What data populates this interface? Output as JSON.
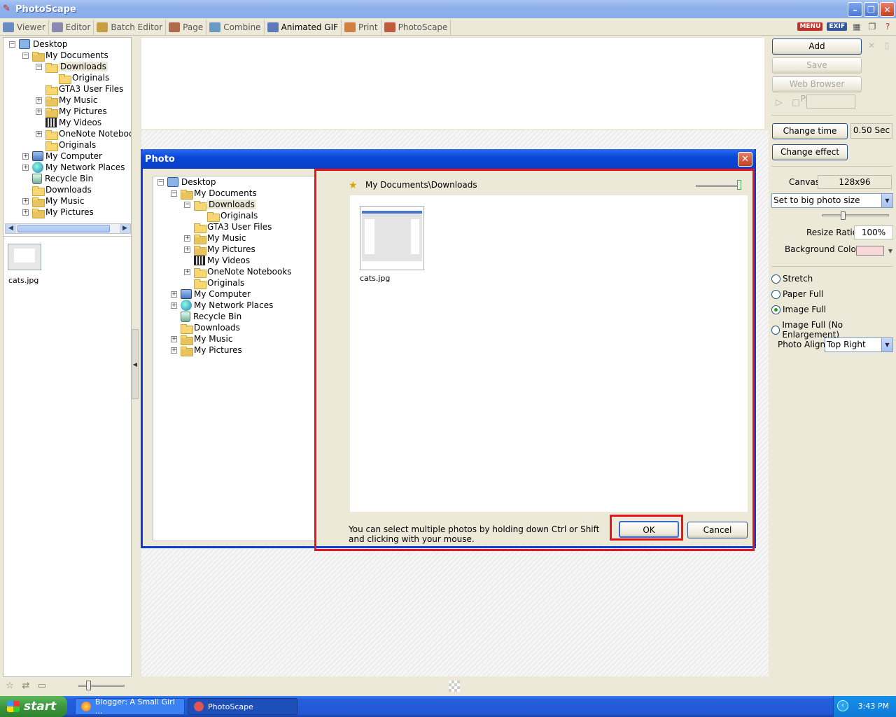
{
  "window": {
    "title": "PhotoScape",
    "buttons": {
      "minimize": "–",
      "restore": "❐",
      "close": "✕"
    }
  },
  "tabs": [
    {
      "label": "Viewer",
      "color": "#6a8cc0"
    },
    {
      "label": "Editor",
      "color": "#8a8ab0"
    },
    {
      "label": "Batch Editor",
      "color": "#c4a040"
    },
    {
      "label": "Page",
      "color": "#b06a4a"
    },
    {
      "label": "Combine",
      "color": "#6a9ac0"
    },
    {
      "label": "Animated GIF",
      "color": "#5a7ab8"
    },
    {
      "label": "Print",
      "color": "#d08040"
    },
    {
      "label": "PhotoScape",
      "color": "#c05a3a"
    }
  ],
  "toolbar": {
    "menu": "MENU",
    "exif": "EXIF"
  },
  "left_tree": [
    {
      "label": "Desktop",
      "icon": "desktop",
      "level": 0,
      "expander": "−"
    },
    {
      "label": "My Documents",
      "icon": "folder-special",
      "level": 1,
      "expander": "−"
    },
    {
      "label": "Downloads",
      "icon": "folder",
      "level": 2,
      "expander": "−",
      "selected": true
    },
    {
      "label": "Originals",
      "icon": "folder",
      "level": 3
    },
    {
      "label": "GTA3 User Files",
      "icon": "folder",
      "level": 2
    },
    {
      "label": "My Music",
      "icon": "folder-special",
      "level": 2,
      "expander": "+"
    },
    {
      "label": "My Pictures",
      "icon": "folder-special",
      "level": 2,
      "expander": "+"
    },
    {
      "label": "My Videos",
      "icon": "film",
      "level": 2
    },
    {
      "label": "OneNote Noteboo",
      "icon": "folder",
      "level": 2,
      "expander": "+"
    },
    {
      "label": "Originals",
      "icon": "folder",
      "level": 2
    },
    {
      "label": "My Computer",
      "icon": "computer",
      "level": 1,
      "expander": "+"
    },
    {
      "label": "My Network Places",
      "icon": "globe",
      "level": 1,
      "expander": "+"
    },
    {
      "label": "Recycle Bin",
      "icon": "bin",
      "level": 1
    },
    {
      "label": "Downloads",
      "icon": "folder",
      "level": 1
    },
    {
      "label": "My Music",
      "icon": "folder-special",
      "level": 1,
      "expander": "+"
    },
    {
      "label": "My Pictures",
      "icon": "folder-special",
      "level": 1,
      "expander": "+"
    }
  ],
  "left_thumbs": {
    "file": "cats.jpg"
  },
  "dialog": {
    "title": "Photo",
    "close": "✕",
    "tree": [
      {
        "label": "Desktop",
        "icon": "desktop",
        "level": 0,
        "expander": "−"
      },
      {
        "label": "My Documents",
        "icon": "folder-special",
        "level": 1,
        "expander": "−"
      },
      {
        "label": "Downloads",
        "icon": "folder",
        "level": 2,
        "expander": "−",
        "selected": true
      },
      {
        "label": "Originals",
        "icon": "folder",
        "level": 3
      },
      {
        "label": "GTA3 User Files",
        "icon": "folder",
        "level": 2
      },
      {
        "label": "My Music",
        "icon": "folder-special",
        "level": 2,
        "expander": "+"
      },
      {
        "label": "My Pictures",
        "icon": "folder-special",
        "level": 2,
        "expander": "+"
      },
      {
        "label": "My Videos",
        "icon": "film",
        "level": 2
      },
      {
        "label": "OneNote Notebooks",
        "icon": "folder",
        "level": 2,
        "expander": "+"
      },
      {
        "label": "Originals",
        "icon": "folder",
        "level": 2
      },
      {
        "label": "My Computer",
        "icon": "computer",
        "level": 1,
        "expander": "+"
      },
      {
        "label": "My Network Places",
        "icon": "globe",
        "level": 1,
        "expander": "+"
      },
      {
        "label": "Recycle Bin",
        "icon": "bin",
        "level": 1
      },
      {
        "label": "Downloads",
        "icon": "folder",
        "level": 1
      },
      {
        "label": "My Music",
        "icon": "folder-special",
        "level": 1,
        "expander": "+"
      },
      {
        "label": "My Pictures",
        "icon": "folder-special",
        "level": 1,
        "expander": "+"
      }
    ],
    "path": "My Documents\\Downloads",
    "files": [
      {
        "name": "cats.jpg"
      }
    ],
    "hint": "You can select multiple photos by holding down Ctrl or Shift and clicking with your mouse.",
    "ok_label": "OK",
    "cancel_label": "Cancel",
    "highlight_color": "#e8141c"
  },
  "right_panel": {
    "add_label": "Add",
    "save_label": "Save",
    "preview_label": "Web Browser Preview",
    "change_time_label": "Change time",
    "time_value": "0.50 Sec",
    "change_effect_label": "Change effect",
    "canvas_label": "Canvas",
    "canvas_value": "128x96",
    "size_mode": "Set to big photo size",
    "resize_ratio_label": "Resize Ratio",
    "resize_ratio_value": "100%",
    "bg_color_label": "Background Color",
    "bg_color": "#f8d8d8",
    "radios": [
      {
        "label": "Stretch",
        "checked": false
      },
      {
        "label": "Paper Full",
        "checked": false
      },
      {
        "label": "Image Full",
        "checked": true
      },
      {
        "label": "Image Full (No Enlargement)",
        "checked": false
      }
    ],
    "photo_align_label": "Photo Align",
    "photo_align_value": "Top Right"
  },
  "taskbar": {
    "start_label": "start",
    "tasks": [
      {
        "label": "Blogger: A Small Girl ...",
        "active": false
      },
      {
        "label": "PhotoScape",
        "active": true
      }
    ],
    "clock": "3:43 PM"
  }
}
